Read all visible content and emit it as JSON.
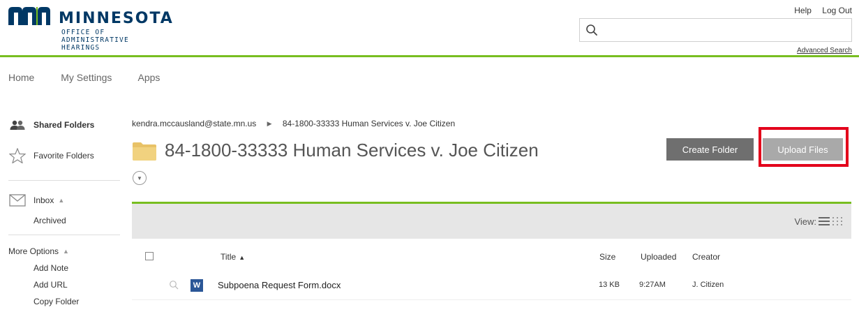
{
  "brand": {
    "name": "MINNESOTA",
    "sub_lines": [
      "OFFICE OF",
      "ADMINISTRATIVE",
      "HEARINGS"
    ],
    "colors": {
      "navy": "#003865",
      "accent_green": "#78be20"
    }
  },
  "toplinks": {
    "help": "Help",
    "logout": "Log Out"
  },
  "search": {
    "placeholder": "",
    "value": "",
    "advanced_label": "Advanced Search",
    "icon": "search-icon"
  },
  "nav": {
    "items": [
      "Home",
      "My Settings",
      "Apps"
    ]
  },
  "sidebar": {
    "shared_folders": "Shared Folders",
    "favorite_folders": "Favorite Folders",
    "inbox": "Inbox",
    "archived": "Archived",
    "more_options": "More Options",
    "options": [
      "Add Note",
      "Add URL",
      "Copy Folder"
    ]
  },
  "breadcrumb": {
    "owner": "kendra.mccausland@state.mn.us",
    "current": "84-1800-33333 Human Services v. Joe Citizen"
  },
  "folder": {
    "title": "84-1800-33333 Human Services v. Joe Citizen"
  },
  "buttons": {
    "create_folder": "Create Folder",
    "upload_files": "Upload Files",
    "highlight_color": "#e3001b"
  },
  "file_list": {
    "view_label": "View:",
    "columns": {
      "title": "Title",
      "size": "Size",
      "uploaded": "Uploaded",
      "creator": "Creator"
    },
    "files": [
      {
        "type_icon": "word-icon",
        "type_letter": "W",
        "name": "Subpoena Request Form.docx",
        "size": "13 KB",
        "uploaded": "9:27AM",
        "creator": "J. Citizen"
      }
    ]
  }
}
